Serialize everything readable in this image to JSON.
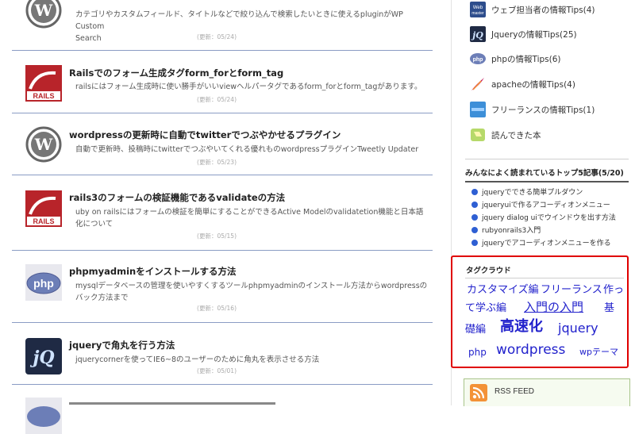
{
  "posts": [
    {
      "title": "",
      "desc_lines": [
        "カテゴリやカスタムフィールド、タイトルなどで絞り込んで検索したいときに使えるpluginがWP Custom",
        "Search"
      ],
      "date": "(更新：05/24)",
      "icon": "wordpress-logo-icon"
    },
    {
      "title": "Railsでのフォーム生成タグform_forとform_tag",
      "desc_lines": [
        "railsにはフォーム生成時に使い勝手がいいviewヘルパータグであるform_forとform_tagがあります。"
      ],
      "date": "(更新：05/24)",
      "icon": "rails-logo-icon"
    },
    {
      "title": "wordpressの更新時に自動でtwitterでつぶやかせるプラグイン",
      "desc_lines": [
        "自動で更新時、投稿時にtwitterでつぶやいてくれる優れものwordpressプラグインTweetly Updater"
      ],
      "date": "(更新：05/23)",
      "icon": "wordpress-logo-icon"
    },
    {
      "title": "rails3のフォームの検証機能であるvalidateの方法",
      "desc_lines": [
        "uby on railsにはフォームの検証を簡単にすることができるActive Modelのvalidatetion機能と日本語",
        "化について"
      ],
      "date": "(更新：05/15)",
      "icon": "rails-logo-icon"
    },
    {
      "title": "phpmyadminをインストールする方法",
      "desc_lines": [
        "mysqlデータベースの管理を使いやすくするツールphpmyadminのインストール方法からwordpressの",
        "バック方法まで"
      ],
      "date": "(更新：05/16)",
      "icon": "php-logo-icon"
    },
    {
      "title": "jqueryで角丸を行う方法",
      "desc_lines": [
        "jquerycornerを使ってIE6~8のユーザーのために角丸を表示させる方法"
      ],
      "date": "(更新：05/01)",
      "icon": "jquery-logo-icon"
    }
  ],
  "sidebar": {
    "categories": [
      {
        "label": "ウェブ担当者の情報Tips(4)",
        "icon": "webmaster-icon"
      },
      {
        "label": "Jqueryの情報Tips(25)",
        "icon": "jquery-icon"
      },
      {
        "label": "phpの情報Tips(6)",
        "icon": "php-icon"
      },
      {
        "label": "apacheの情報Tips(4)",
        "icon": "apache-feather-icon"
      },
      {
        "label": "フリーランスの情報Tips(1)",
        "icon": "freelance-icon"
      },
      {
        "label": "読んできた本",
        "icon": "book-icon"
      }
    ],
    "ranking_title": "みんなによく読まれているトップ5記事(5/20)",
    "ranking": [
      "jqueryでできる簡単プルダウン",
      "jqueryuiで作るアコーディオンメニュー",
      "jquery dialog uiでウインドウを出す方法",
      "rubyonrails3入門",
      "jqueryでアコーディオンメニューを作る"
    ],
    "tagcloud_title": "タグクラウド",
    "tags": [
      "カスタマイズ編",
      "フリーランス",
      "作っ",
      "て学ぶ編",
      "入門の入門",
      "基",
      "礎編",
      "高速化",
      "jquery",
      "php",
      "wordpress",
      "wpテーマ"
    ],
    "rss_label": "RSS FEED"
  },
  "colors": {
    "accent_blue": "#2222cc",
    "separator": "#8a9cc4",
    "highlight_box": "#e00000",
    "rss_orange": "#f39237"
  }
}
